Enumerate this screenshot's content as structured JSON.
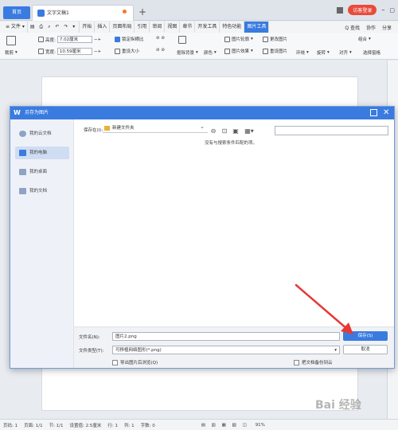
{
  "titlebar": {
    "home_tab": "首页",
    "doc_tab": "文字文稿1",
    "new_tab": "+",
    "login": "访客登录"
  },
  "menubar": {
    "file": "≡ 文件 ▾",
    "items": [
      "开始",
      "插入",
      "页面布局",
      "引用",
      "审阅",
      "视图",
      "章节",
      "开发工具",
      "特色功能",
      "图片工具"
    ],
    "active_index": 9,
    "search": "Q 查找",
    "collab": "协作",
    "share": "分享"
  },
  "ribbon": {
    "height_label": "高度:",
    "height_value": "7.02厘米",
    "width_label": "宽度:",
    "width_value": "10.59厘米",
    "lock_ratio": "锁定纵横比",
    "reset_size": "重设大小",
    "crop": "裁剪",
    "remove_bg": "抠除背景",
    "color": "颜色",
    "pic_outline": "图片轮廓",
    "pic_effect": "图片效果",
    "change_pic": "更改图片",
    "reset_pic": "重设图片",
    "wrap": "环绕",
    "rotate": "旋转",
    "align": "对齐",
    "group": "组合",
    "select_pane": "选择窗格"
  },
  "statusbar": {
    "page": "页码: 1",
    "pages": "页面: 1/1",
    "section": "节: 1/1",
    "setting": "设置值: 2.5厘米",
    "row": "行: 1",
    "col": "列: 1",
    "words": "字数: 0",
    "zoom": "91%"
  },
  "dialog": {
    "title": "另存为图片",
    "sidebar": [
      "我的云文档",
      "我的电脑",
      "我的桌面",
      "我的文档"
    ],
    "selected_index": 1,
    "save_in_label": "保存在(I):",
    "folder": "新建文件夹",
    "empty_message": "没有与搜索条件匹配的项。",
    "filename_label": "文件名(N):",
    "filename_value": "图片2.png",
    "filetype_label": "文件类型(T):",
    "filetype_value": "可移植网络图形(*.png)",
    "save_button": "保存(S)",
    "cancel_button": "取消",
    "export_browse": "导出图片后浏览(Q)",
    "backup_cloud": "把文档备份到云"
  },
  "watermark": "Bai 经验",
  "colors": {
    "accent": "#3a7be0",
    "arrow": "#e53935",
    "login": "#e84b3c"
  }
}
